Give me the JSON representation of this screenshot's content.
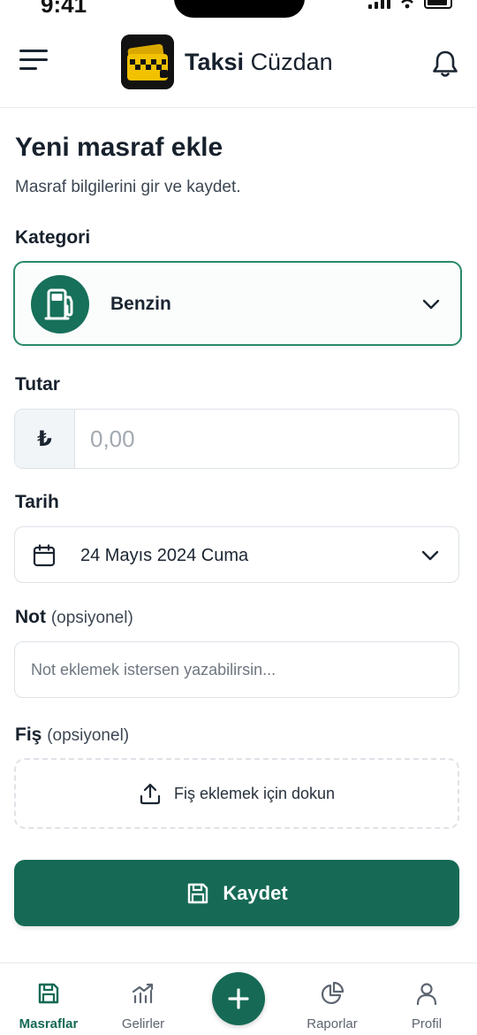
{
  "status_bar": {
    "time": "9:41"
  },
  "header": {
    "brand_bold": "Taksi",
    "brand_regular": "Cüzdan",
    "menu_icon": "hamburger-menu-icon",
    "notification_icon": "bell-icon",
    "logo_icon": "taxi-wallet-logo"
  },
  "form": {
    "title": "Yeni masraf ekle",
    "subtitle": "Masraf bilgilerini gir ve kaydet.",
    "category": {
      "label": "Kategori",
      "value": "Benzin",
      "icon": "fuel-pump-icon"
    },
    "amount": {
      "label": "Tutar",
      "currency_symbol": "₺",
      "placeholder": "0,00"
    },
    "date": {
      "label": "Tarih",
      "value": "24 Mayıs 2024 Cuma",
      "icon": "calendar-icon"
    },
    "note": {
      "label": "Not",
      "optional": "(opsiyonel)",
      "placeholder": "Not eklemek istersen yazabilirsin..."
    },
    "receipt": {
      "label": "Fiş",
      "optional": "(opsiyonel)",
      "action": "Fiş eklemek için dokun",
      "icon": "upload-icon"
    },
    "save_label": "Kaydet"
  },
  "nav": {
    "items": [
      {
        "label": "Masraflar",
        "icon": "floppy-icon",
        "active": true
      },
      {
        "label": "Gelirler",
        "icon": "chart-icon",
        "active": false
      },
      {
        "label": "Raporlar",
        "icon": "pie-icon",
        "active": false
      },
      {
        "label": "Profil",
        "icon": "user-icon",
        "active": false
      }
    ],
    "fab_icon": "plus-icon"
  },
  "colors": {
    "primary": "#166a55",
    "accent_border": "#2a8a6a",
    "text": "#17212d",
    "logo_yellow": "#f2c200"
  }
}
